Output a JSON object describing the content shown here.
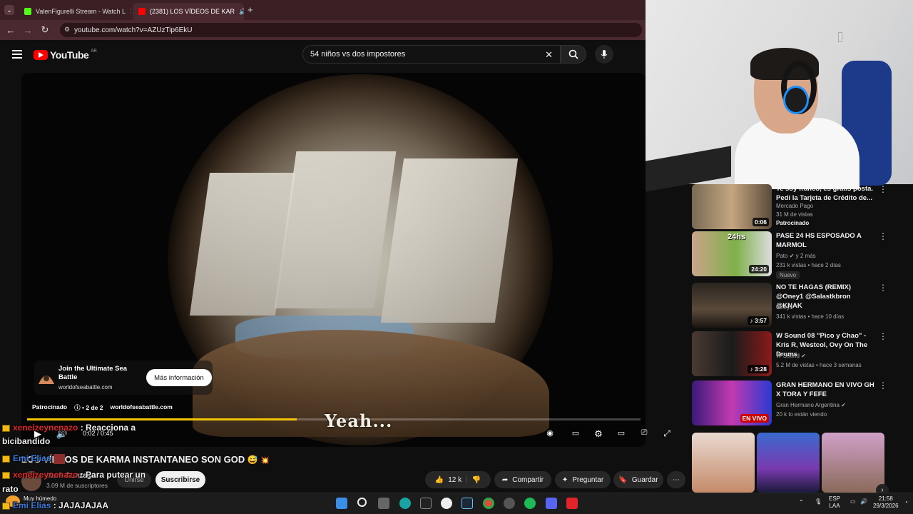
{
  "browser": {
    "tabs": [
      {
        "label": "ValenFigurelli Stream - Watch L",
        "active": false
      },
      {
        "label": "(2381) LOS VÍDEOS DE KAR",
        "active": true
      }
    ],
    "url": "youtube.com/watch?v=AZUzTip6EkU"
  },
  "youtube": {
    "logo": "YouTube",
    "country": "AR",
    "search_value": "54 niños vs dos impostores"
  },
  "video": {
    "ad_title": "Join the Ultimate Sea Battle",
    "ad_domain": "worldofseabattle.com",
    "ad_button": "Más información",
    "sponsored": "Patrocinado",
    "ad_count": "• 2 de 2",
    "sponsor_domain": "worldofseabattle.com",
    "subtitle": "Yeah...",
    "time": "0:02 / 0:45",
    "progress_fraction": 0.44,
    "accent_color": "#f2c400"
  },
  "below": {
    "title": "LOS VÍDEOS DE KARMA INSTANTANEO SON GOD",
    "channel": "Mark Gonzaga",
    "subscribers": "3.09 M de suscriptores",
    "join": "Unirse",
    "subscribe": "Suscribirse",
    "likes": "12 k",
    "share": "Compartir",
    "ask": "Preguntar",
    "save": "Guardar"
  },
  "chat": [
    {
      "user": "xeneizeynenazo",
      "text": ": Reacciona a"
    },
    {
      "user": "",
      "text": "bicibandido"
    },
    {
      "user": "Emi Elias",
      "text": ""
    },
    {
      "user": "xeneizeynenazo",
      "text": ": Para putear un"
    },
    {
      "user": "",
      "text": "rato"
    },
    {
      "user": "Emi Elias",
      "text": ": JAJAJAJAA"
    }
  ],
  "sidebar": [
    {
      "title": "Te soy franco, es gratis posta. Pedí la Tarjeta de Crédito de...",
      "channel": "Mercado Pago",
      "meta": "31 M de vistas",
      "extra": "Patrocinado",
      "duration": "0:06"
    },
    {
      "title": "PASE 24 HS ESPOSADO A MARMOL",
      "channel": "Pato",
      "meta": "231 k vistas • hace 2 días",
      "extra": "Nuevo",
      "duration": "24:20",
      "channel_meta": "y 2 más"
    },
    {
      "title": "NO TE HAGAS (REMIX) @Oney1 @Salastkbron @KNAK",
      "channel": "Oney1",
      "meta": "341 k vistas • hace 10 días",
      "duration": "3:57"
    },
    {
      "title": "W Sound 08 \"Pico y Chao\" - Kris R, Westcol, Ovy On The Drums",
      "channel": "W Sound",
      "meta": "5.2 M de vistas • hace 3 semanas",
      "duration": "3:28"
    },
    {
      "title": "GRAN HERMANO EN VIVO GH X TORA Y FEFE",
      "channel": "Gran Hermano Argentina",
      "meta": "20 k lo están viendo",
      "duration": "EN VIVO"
    }
  ],
  "taskbar": {
    "weather": "Muy húmedo",
    "lang1": "ESP",
    "lang2": "LAA",
    "time": "21:58",
    "date": "29/3/2026"
  }
}
